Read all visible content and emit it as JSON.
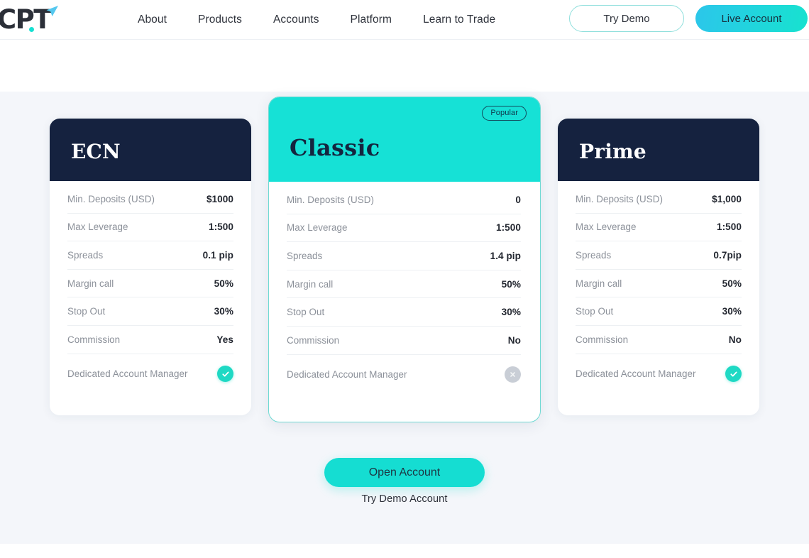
{
  "brand": {
    "logo_text": "CPT",
    "logo_icon": "paper-plane-icon",
    "accent_teal": "#16e1d6",
    "accent_navy": "#15223f",
    "page_background": "#f4f6fa"
  },
  "header": {
    "nav_links": [
      {
        "label": "About"
      },
      {
        "label": "Products"
      },
      {
        "label": "Accounts"
      },
      {
        "label": "Platform"
      },
      {
        "label": "Learn to Trade"
      }
    ],
    "try_demo_label": "Try Demo",
    "live_account_label": "Live Account"
  },
  "cards": [
    {
      "title": "ECN",
      "featured": false,
      "badge": null,
      "rows": [
        {
          "label": "Min. Deposits (USD)",
          "value": "$1000",
          "type": "text"
        },
        {
          "label": "Max Leverage",
          "value": "1:500",
          "type": "text"
        },
        {
          "label": "Spreads",
          "value": "0.1 pip",
          "type": "text"
        },
        {
          "label": "Margin call",
          "value": "50%",
          "type": "text"
        },
        {
          "label": "Stop Out",
          "value": "30%",
          "type": "text"
        },
        {
          "label": "Commission",
          "value": "Yes",
          "type": "text"
        },
        {
          "label": "Dedicated Account Manager",
          "value": "yes",
          "type": "mark"
        }
      ]
    },
    {
      "title": "Classic",
      "featured": true,
      "badge": "Popular",
      "rows": [
        {
          "label": "Min. Deposits (USD)",
          "value": "0",
          "type": "text"
        },
        {
          "label": "Max Leverage",
          "value": "1:500",
          "type": "text"
        },
        {
          "label": "Spreads",
          "value": "1.4 pip",
          "type": "text"
        },
        {
          "label": "Margin call",
          "value": "50%",
          "type": "text"
        },
        {
          "label": "Stop Out",
          "value": "30%",
          "type": "text"
        },
        {
          "label": "Commission",
          "value": "No",
          "type": "text"
        },
        {
          "label": "Dedicated Account Manager",
          "value": "no",
          "type": "mark"
        }
      ]
    },
    {
      "title": "Prime",
      "featured": false,
      "badge": null,
      "rows": [
        {
          "label": "Min. Deposits (USD)",
          "value": "$1,000",
          "type": "text"
        },
        {
          "label": "Max Leverage",
          "value": "1:500",
          "type": "text"
        },
        {
          "label": "Spreads",
          "value": "0.7pip",
          "type": "text"
        },
        {
          "label": "Margin call",
          "value": "50%",
          "type": "text"
        },
        {
          "label": "Stop Out",
          "value": "30%",
          "type": "text"
        },
        {
          "label": "Commission",
          "value": "No",
          "type": "text"
        },
        {
          "label": "Dedicated Account Manager",
          "value": "yes",
          "type": "mark"
        }
      ]
    }
  ],
  "cta": {
    "open_account_label": "Open Account",
    "try_demo_account_label": "Try Demo Account"
  }
}
